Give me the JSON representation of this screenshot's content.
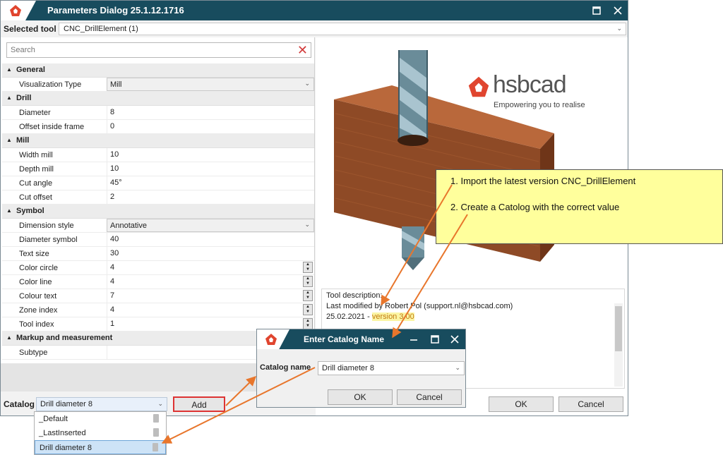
{
  "window": {
    "title": "Parameters Dialog 25.1.12.1716",
    "selected_tool_label": "Selected tool",
    "selected_tool_value": "CNC_DrillElement (1)"
  },
  "search": {
    "placeholder": "Search"
  },
  "properties": {
    "general": {
      "label": "General",
      "rows": [
        {
          "name": "Visualization Type",
          "value": "Mill"
        }
      ]
    },
    "drill": {
      "label": "Drill",
      "rows": [
        {
          "name": "Diameter",
          "value": "8"
        },
        {
          "name": "Offset inside frame",
          "value": "0"
        }
      ]
    },
    "mill": {
      "label": "Mill",
      "rows": [
        {
          "name": "Width mill",
          "value": "10"
        },
        {
          "name": "Depth mill",
          "value": "10"
        },
        {
          "name": "Cut angle",
          "value": "45°"
        },
        {
          "name": "Cut offset",
          "value": "2"
        }
      ]
    },
    "symbol": {
      "label": "Symbol",
      "rows": [
        {
          "name": "Dimension style",
          "value": "Annotative"
        },
        {
          "name": "Diameter symbol",
          "value": "40"
        },
        {
          "name": "Text size",
          "value": "30"
        },
        {
          "name": "Color circle",
          "value": "4"
        },
        {
          "name": "Color line",
          "value": "4"
        },
        {
          "name": "Colour text",
          "value": "7"
        },
        {
          "name": "Zone index",
          "value": "4"
        },
        {
          "name": "Tool index",
          "value": "1"
        }
      ]
    },
    "markup": {
      "label": "Markup and measurement",
      "rows": [
        {
          "name": "Subtype",
          "value": ""
        }
      ]
    }
  },
  "brand": {
    "name": "hsbcad",
    "tagline": "Empowering you to realise"
  },
  "tool_description": {
    "heading": "Tool description:",
    "modified": "Last modified by Robert Pol (support.nl@hsbcad.com)",
    "date": "25.02.2021 - ",
    "version": "version 3.00"
  },
  "catalog": {
    "label": "Catalog",
    "value": "Drill diameter 8",
    "add_label": "Add",
    "items": [
      "_Default",
      "_LastInserted",
      "Drill diameter 8"
    ]
  },
  "buttons": {
    "ok": "OK",
    "cancel": "Cancel"
  },
  "popup": {
    "title": "Enter Catalog Name",
    "label": "Catalog name",
    "value": "Drill diameter 8",
    "ok": "OK",
    "cancel": "Cancel"
  },
  "annotation": {
    "step1": "1. Import the latest version CNC_DrillElement",
    "step2": "2. Create a Catolog with the correct value"
  },
  "colors": {
    "titlebar": "#184c5e",
    "logo": "#e0452f",
    "note_bg": "#ffff9c",
    "arrow": "#e8762c",
    "highlight_text": "#c27a10"
  }
}
